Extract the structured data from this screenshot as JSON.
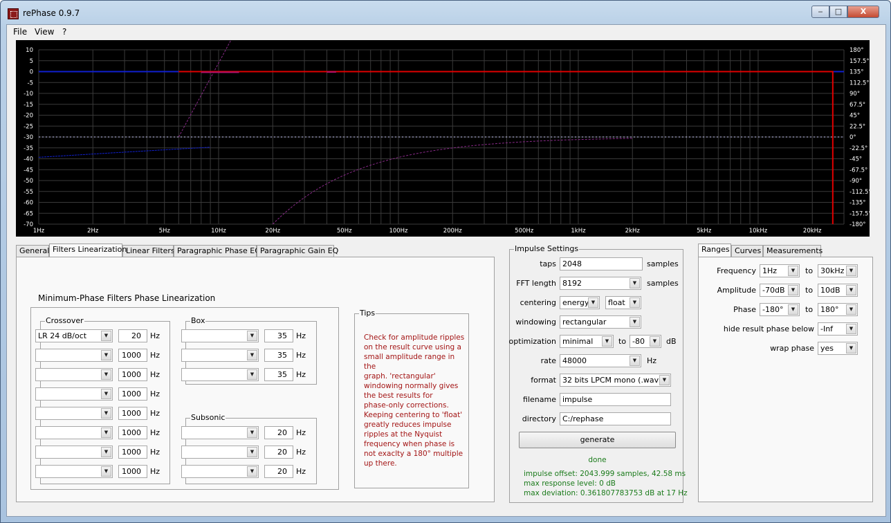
{
  "window": {
    "title": "rePhase 0.9.7",
    "min_glyph": "‒",
    "max_glyph": "□",
    "close_glyph": "X"
  },
  "menu": [
    "File",
    "View",
    "?"
  ],
  "graph": {
    "left_ticks": [
      "10",
      "5",
      "0",
      "-5",
      "-10",
      "-15",
      "-20",
      "-25",
      "-30",
      "-35",
      "-40",
      "-45",
      "-50",
      "-55",
      "-60",
      "-65",
      "-70"
    ],
    "right_ticks": [
      "180°",
      "157.5°",
      "135°",
      "112.5°",
      "90°",
      "67.5°",
      "45°",
      "22.5°",
      "0°",
      "-22.5°",
      "-45°",
      "-67.5°",
      "-90°",
      "-112.5°",
      "-135°",
      "-157.5°",
      "-180°"
    ],
    "x_ticks": [
      "1Hz",
      "2Hz",
      "5Hz",
      "10Hz",
      "20Hz",
      "50Hz",
      "100Hz",
      "200Hz",
      "500Hz",
      "1kHz",
      "2kHz",
      "5kHz",
      "10kHz",
      "20kHz"
    ],
    "colors": {
      "bg": "#000000",
      "grid": "#3a3a3a",
      "red": "#e00000",
      "blue": "#1020d0",
      "purple": "#8a2a8a"
    }
  },
  "tabs_left": [
    "General",
    "Filters Linearization",
    "Linear Filters",
    "Paragraphic Phase EQ",
    "Paragraphic Gain EQ"
  ],
  "filters": {
    "heading": "Minimum-Phase Filters Phase Linearization",
    "crossover": {
      "label": "Crossover",
      "rows": [
        {
          "type": "LR  24 dB/oct",
          "freq": "20",
          "unit": "Hz"
        },
        {
          "type": "",
          "freq": "1000",
          "unit": "Hz"
        },
        {
          "type": "",
          "freq": "1000",
          "unit": "Hz"
        },
        {
          "type": "",
          "freq": "1000",
          "unit": "Hz"
        },
        {
          "type": "",
          "freq": "1000",
          "unit": "Hz"
        },
        {
          "type": "",
          "freq": "1000",
          "unit": "Hz"
        },
        {
          "type": "",
          "freq": "1000",
          "unit": "Hz"
        },
        {
          "type": "",
          "freq": "1000",
          "unit": "Hz"
        }
      ]
    },
    "box": {
      "label": "Box",
      "rows": [
        {
          "type": "",
          "freq": "35",
          "unit": "Hz"
        },
        {
          "type": "",
          "freq": "35",
          "unit": "Hz"
        },
        {
          "type": "",
          "freq": "35",
          "unit": "Hz"
        }
      ]
    },
    "subsonic": {
      "label": "Subsonic",
      "rows": [
        {
          "type": "",
          "freq": "20",
          "unit": "Hz"
        },
        {
          "type": "",
          "freq": "20",
          "unit": "Hz"
        },
        {
          "type": "",
          "freq": "20",
          "unit": "Hz"
        }
      ]
    },
    "tips": {
      "label": "Tips",
      "p1": [
        "Check for amplitude ripples",
        "on the result curve using a",
        "small amplitude range in the",
        "graph. 'rectangular'",
        "windowing normally gives",
        "the best results for",
        "phase-only corrections."
      ],
      "p2": [
        "Keeping centering to 'float'",
        "greatly reduces impulse",
        "ripples at the Nyquist",
        "frequency when phase is",
        "not exaclty a 180° multiple",
        "up there."
      ]
    }
  },
  "impulse": {
    "label": "Impulse Settings",
    "taps_label": "taps",
    "taps": "2048",
    "taps_unit": "samples",
    "fft_label": "FFT length",
    "fft": "8192",
    "fft_unit": "samples",
    "centering_label": "centering",
    "centering": "energy",
    "centering2": "float",
    "windowing_label": "windowing",
    "windowing": "rectangular",
    "optimization_label": "optimization",
    "optimization": "minimal",
    "opt_to": "to",
    "opt_db": "-80",
    "opt_unit": "dB",
    "rate_label": "rate",
    "rate": "48000",
    "rate_unit": "Hz",
    "format_label": "format",
    "format": "32 bits LPCM mono (.wav)",
    "filename_label": "filename",
    "filename": "impulse",
    "directory_label": "directory",
    "directory": "C:/rephase",
    "generate": "generate",
    "status_done": "done",
    "status_offset": "impulse offset: 2043.999 samples, 42.58 ms",
    "status_level": "max response level: 0 dB",
    "status_dev": "max deviation: 0.361807783753 dB at 17 Hz"
  },
  "tabs_right": [
    "Ranges",
    "Curves",
    "Measurements"
  ],
  "ranges": {
    "frequency_label": "Frequency",
    "freq_from": "1Hz",
    "freq_to": "30kHz",
    "amplitude_label": "Amplitude",
    "amp_from": "-70dB",
    "amp_to": "10dB",
    "phase_label": "Phase",
    "phase_from": "-180°",
    "phase_to": "180°",
    "to": "to",
    "hide_label": "hide result phase below",
    "hide": "-Inf",
    "wrap_label": "wrap phase",
    "wrap": "yes"
  }
}
